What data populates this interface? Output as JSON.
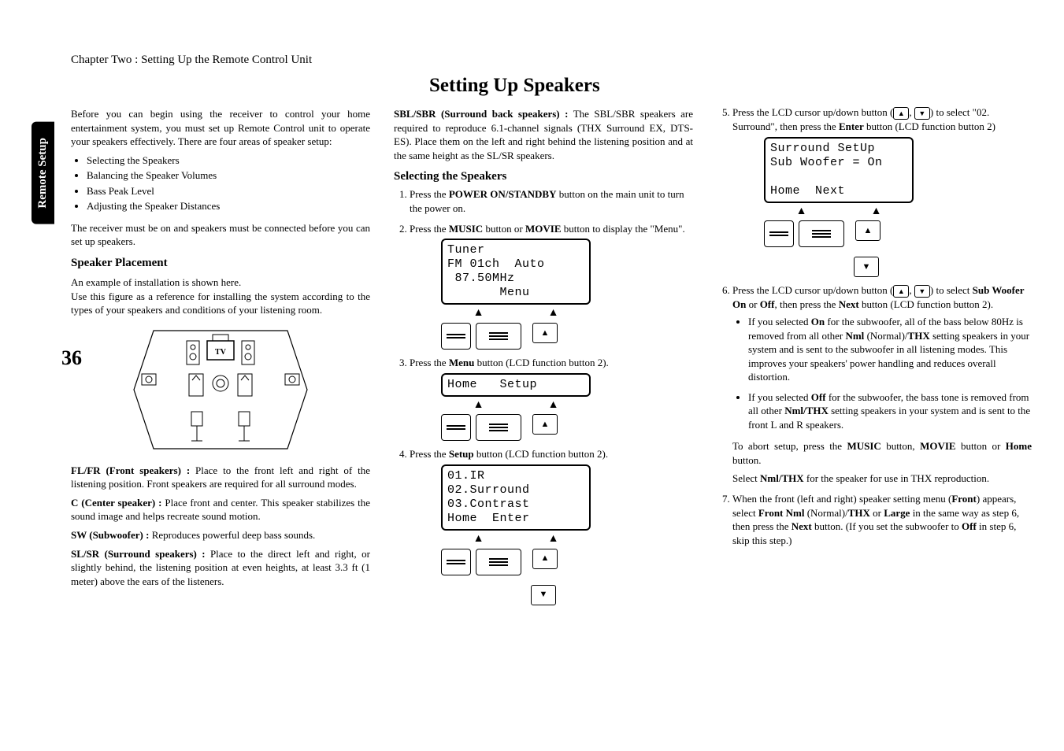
{
  "sidebar": {
    "label": "Remote Setup"
  },
  "page_number": "36",
  "chapter": "Chapter Two : Setting Up the Remote Control Unit",
  "title": "Setting Up Speakers",
  "col1": {
    "intro": "Before you can begin using the receiver to control your home entertainment system, you must set up Remote Control unit to operate your speakers effectively. There are four areas of speaker setup:",
    "areas": [
      "Selecting the Speakers",
      "Balancing the Speaker Volumes",
      "Bass Peak Level",
      "Adjusting the Speaker Distances"
    ],
    "prereq": "The receiver must be on and speakers must be connected before you can set up speakers.",
    "placement_heading": "Speaker Placement",
    "placement_intro1": "An example of installation is shown here.",
    "placement_intro2": "Use this figure as a reference for installing the system according to the types of your speakers and conditions of your listening room.",
    "fl_fr": {
      "label": "FL/FR (Front speakers) :",
      "text": " Place to the front left and right of the listening position. Front speakers are required for all surround modes."
    },
    "c": {
      "label": "C (Center speaker) :",
      "text": " Place front and center. This speaker stabilizes the sound image and helps recreate sound motion."
    },
    "sw": {
      "label": "SW (Subwoofer) :",
      "text": " Reproduces powerful deep bass sounds."
    },
    "sl_sr": {
      "label": "SL/SR (Surround speakers) :",
      "text": " Place to the direct left and right, or slightly behind, the listening position  at even heights, at least 3.3 ft (1 meter) above the ears of the listeners."
    }
  },
  "col2": {
    "sbl_sbr": {
      "label": "SBL/SBR (Surround back speakers) :",
      "text": " The SBL/SBR speakers are required to reproduce 6.1-channel signals (THX Surround EX, DTS-ES). Place them on the left and right behind the listening position and at the same height as the SL/SR speakers."
    },
    "selecting_heading": "Selecting the Speakers",
    "step1_a": "Press the ",
    "step1_b": "POWER ON/STANDBY",
    "step1_c": " button on the main unit to turn the power on.",
    "step2_a": "Press the ",
    "step2_b": "MUSIC",
    "step2_c": " button or ",
    "step2_d": "MOVIE",
    "step2_e": " button to display the \"Menu\".",
    "lcd_tuner": "Tuner\nFM 01ch  Auto\n 87.50MHz\n       Menu",
    "step3_a": "Press the ",
    "step3_b": "Menu",
    "step3_c": " button (LCD function button 2).",
    "lcd_homesetup": "Home   Setup",
    "step4_a": "Press the ",
    "step4_b": "Setup",
    "step4_c": " button (LCD function button 2).",
    "lcd_menu": "01.IR\n02.Surround\n03.Contrast\nHome  Enter"
  },
  "col3": {
    "step5_a": "Press the LCD cursor up/down button (",
    "step5_b": ") to select \"02. Surround\", then press the ",
    "step5_c": "Enter",
    "step5_d": " button (LCD function button 2)",
    "lcd_surround": "Surround SetUp\nSub Woofer = On\n\nHome  Next",
    "step6_a": "Press the LCD cursor up/down button (",
    "step6_b": ") to select ",
    "step6_c": "Sub Woofer On",
    "step6_d": " or ",
    "step6_e": "Off",
    "step6_f": ", then press the ",
    "step6_g": "Next",
    "step6_h": " button (LCD function button 2).",
    "bullet_on_a": "If you selected ",
    "bullet_on_b": "On",
    "bullet_on_c": " for the subwoofer, all of the bass below 80Hz is removed from all other ",
    "bullet_on_d": "Nml",
    "bullet_on_e": " (Normal)/",
    "bullet_on_f": "THX",
    "bullet_on_g": " setting speakers in your system and is sent to the subwoofer in all listening modes. This improves your speakers' power handling and reduces overall distortion.",
    "bullet_off_a": "If you selected ",
    "bullet_off_b": "Off",
    "bullet_off_c": " for the subwoofer, the bass tone is removed from all other ",
    "bullet_off_d": "Nml/THX",
    "bullet_off_e": " setting speakers in your system and is sent to the front L and R speakers.",
    "abort_a": "To abort setup, press the ",
    "abort_b": "MUSIC",
    "abort_c": " button, ",
    "abort_d": "MOVIE",
    "abort_e": " button or ",
    "abort_f": "Home",
    "abort_g": " button.",
    "select_a": "Select ",
    "select_b": "Nml/THX",
    "select_c": " for the speaker for use in THX reproduction.",
    "step7_a": "When the front (left and right) speaker setting menu (",
    "step7_b": "Front",
    "step7_c": ") appears, select ",
    "step7_d": "Front Nml",
    "step7_e": " (Normal)/",
    "step7_f": "THX",
    "step7_g": " or ",
    "step7_h": "Large",
    "step7_i": " in the same way as step 6, then press the ",
    "step7_j": "Next",
    "step7_k": " button. (If you set the subwoofer to ",
    "step7_l": "Off",
    "step7_m": " in step 6, skip this step.)"
  }
}
